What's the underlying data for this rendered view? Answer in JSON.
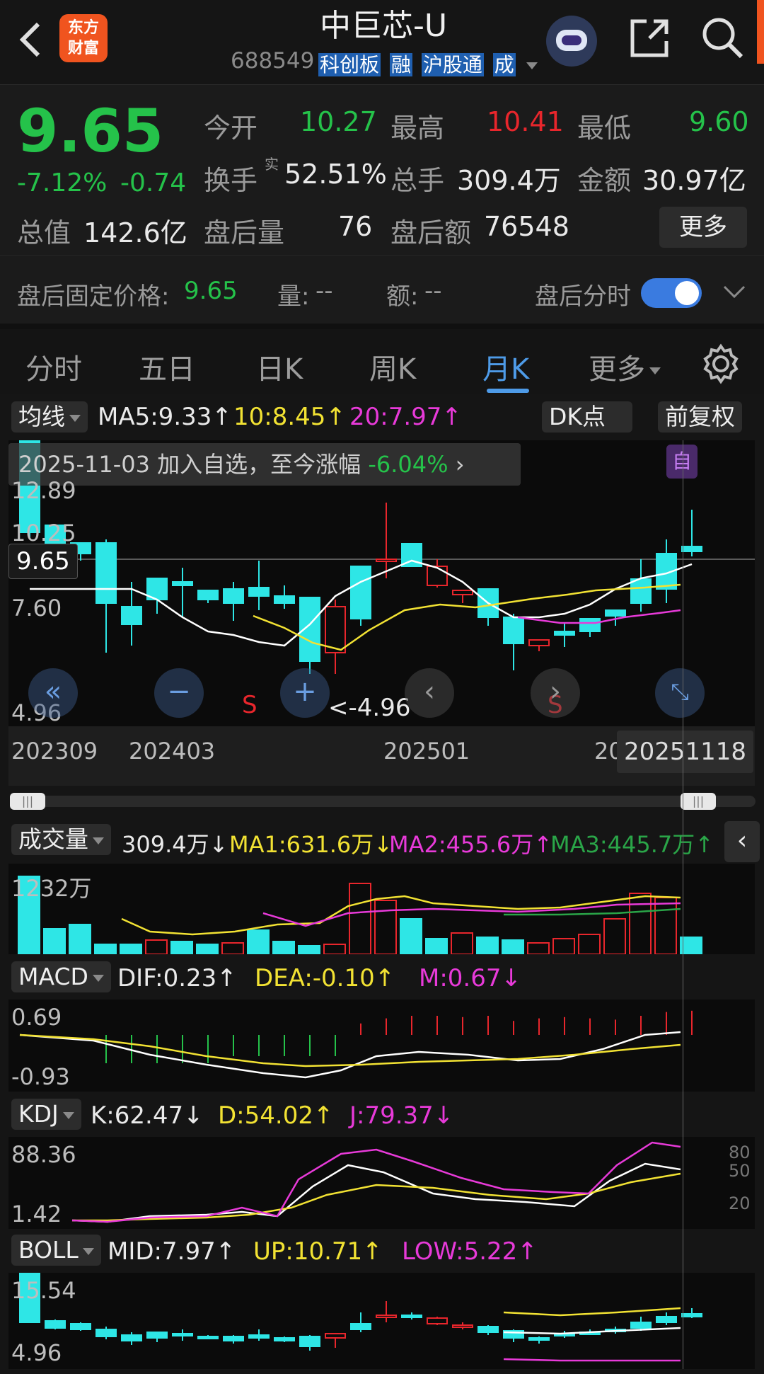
{
  "header": {
    "title": "中巨芯-U",
    "code": "688549",
    "badges": [
      "科创板",
      "融",
      "沪股通",
      "成"
    ],
    "logo_top": "东方",
    "logo_bottom": "财富"
  },
  "quote": {
    "price": "9.65",
    "change_pct": "-7.12%",
    "change_amt": "-0.74",
    "open_label": "今开",
    "open": "10.27",
    "high_label": "最高",
    "high": "10.41",
    "low_label": "最低",
    "low": "9.60",
    "turnover_label": "换手",
    "turnover_sup": "实",
    "turnover": "52.51%",
    "volume_label": "总手",
    "volume": "309.4万",
    "amount_label": "金额",
    "amount": "30.97亿",
    "mktcap_label": "总值",
    "mktcap": "142.6亿",
    "ah_vol_label": "盘后量",
    "ah_vol": "76",
    "ah_amt_label": "盘后额",
    "ah_amt": "76548",
    "more": "更多"
  },
  "afterhours": {
    "label": "盘后固定价格:",
    "price": "9.65",
    "vol_label": "量:",
    "vol": "--",
    "amt_label": "额:",
    "amt": "--",
    "toggle_label": "盘后分时",
    "toggle_on": true
  },
  "tabs": [
    "分时",
    "五日",
    "日K",
    "周K",
    "月K",
    "更多"
  ],
  "active_tab": "月K",
  "ma_bar": {
    "selector": "均线",
    "ma5": "MA5:9.33↑",
    "ma10": "10:8.45↑",
    "ma20": "20:7.97↑",
    "dk": "DK点",
    "fq": "前复权"
  },
  "banner": {
    "date": "2025-11-03",
    "text": "加入自选，至今涨幅",
    "pct": "-6.04%",
    "flag": "自"
  },
  "price_axis": {
    "top": "12.89",
    "mid1": "10.25",
    "mid2": "7.60",
    "bottom": "4.96",
    "current": "9.65",
    "min_marker": "<-4.96",
    "signal_s": "S"
  },
  "date_axis": {
    "d1": "202309",
    "d2": "202403",
    "d3": "202501",
    "d4": "20",
    "d5": "20251118"
  },
  "vol_bar": {
    "selector": "成交量",
    "val": "309.4万↓",
    "ma1": "MA1:631.6万↓",
    "ma2": "MA2:455.6万↑",
    "ma3": "MA3:445.7万↑",
    "axis": "1232万"
  },
  "macd_bar": {
    "selector": "MACD",
    "dif": "DIF:0.23↑",
    "dea": "DEA:-0.10↑",
    "m": "M:0.67↓",
    "top": "0.69",
    "bottom": "-0.93"
  },
  "kdj_bar": {
    "selector": "KDJ",
    "k": "K:62.47↓",
    "d": "D:54.02↑",
    "j": "J:79.37↓",
    "top": "88.36",
    "bottom": "1.42",
    "r80": "80",
    "r50": "50",
    "r20": "20"
  },
  "boll_bar": {
    "selector": "BOLL",
    "mid": "MID:7.97↑",
    "up": "UP:10.71↑",
    "low": "LOW:5.22↑",
    "top": "15.54",
    "bottom": "4.96"
  },
  "colors": {
    "up": "#e8262c",
    "down": "#2ee6e6",
    "green": "#25c24a",
    "accent": "#4e9be8",
    "ma5": "#ffffff",
    "ma10": "#f2e233",
    "ma20": "#e83ad9"
  },
  "icons": [
    "back-arrow-icon",
    "avatar-robot-icon",
    "share-icon",
    "search-icon",
    "gear-icon",
    "double-left-icon",
    "zoom-out-icon",
    "zoom-in-icon",
    "left-icon",
    "right-icon",
    "expand-icon"
  ]
}
